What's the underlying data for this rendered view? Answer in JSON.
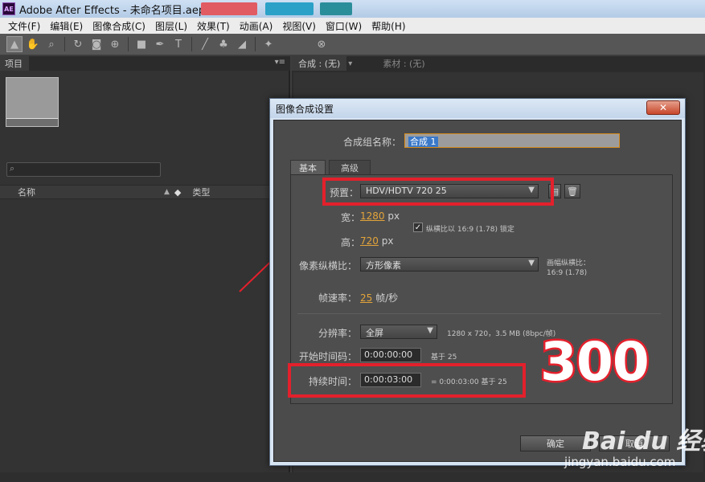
{
  "window": {
    "title": "Adobe After Effects - 未命名项目.aep",
    "logo": "AE"
  },
  "menu": [
    "文件(F)",
    "编辑(E)",
    "图像合成(C)",
    "图层(L)",
    "效果(T)",
    "动画(A)",
    "视图(V)",
    "窗口(W)",
    "帮助(H)"
  ],
  "toolbar": {
    "icons": [
      "selection-tool-icon",
      "hand-tool-icon",
      "zoom-tool-icon",
      "rotate-tool-icon",
      "camera-tool-icon",
      "pan-behind-tool-icon",
      "rectangle-tool-icon",
      "pen-tool-icon",
      "text-tool-icon",
      "brush-tool-icon",
      "clone-stamp-tool-icon",
      "eraser-tool-icon",
      "puppet-pin-tool-icon"
    ]
  },
  "project_panel": {
    "tab_label": "项目",
    "columns": {
      "name": "名称",
      "type": "类型"
    }
  },
  "comp_panel": {
    "tab_comp": "合成 : (无)",
    "tab_footage": "素材 : (无)"
  },
  "dialog": {
    "title": "图像合成设置",
    "close_label": "✕",
    "comp_name_label": "合成组名称：",
    "comp_name_value": "合成 1",
    "tabs": {
      "basic": "基本",
      "advanced": "高级"
    },
    "preset_label": "预置：",
    "preset_value": "HDV/HDTV 720 25",
    "width_label": "宽：",
    "width_value": "1280",
    "width_unit": "px",
    "height_label": "高：",
    "height_value": "720",
    "height_unit": "px",
    "lock_aspect_label": "纵横比以 16:9 (1.78) 锁定",
    "lock_aspect_checked": true,
    "pixel_aspect_label": "像素纵横比：",
    "pixel_aspect_value": "方形像素",
    "frame_aspect_title": "画幅纵横比：",
    "frame_aspect_value": "16:9 (1.78)",
    "frame_rate_label": "帧速率：",
    "frame_rate_value": "25",
    "frame_rate_unit": "帧/秒",
    "resolution_label": "分辨率：",
    "resolution_value": "全屏",
    "resolution_info": "1280 x 720，3.5 MB (8bpc/帧)",
    "start_tc_label": "开始时间码：",
    "start_tc_value": "0:00:00:00",
    "start_tc_base": "基于 25",
    "duration_label": "持续时间：",
    "duration_value": "0:00:03:00",
    "duration_info": "= 0:00:03:00  基于 25",
    "ok_label": "确定",
    "cancel_label": "取消"
  },
  "annotation": {
    "text": "300",
    "color": "#e3202c"
  },
  "watermark": {
    "line1": "Bai du 经验",
    "line2": "jingyan.baidu.com"
  },
  "colors": {
    "accent_value": "#e3a43a",
    "highlight": "#3a78c8",
    "annotation_red": "#e3202c"
  }
}
